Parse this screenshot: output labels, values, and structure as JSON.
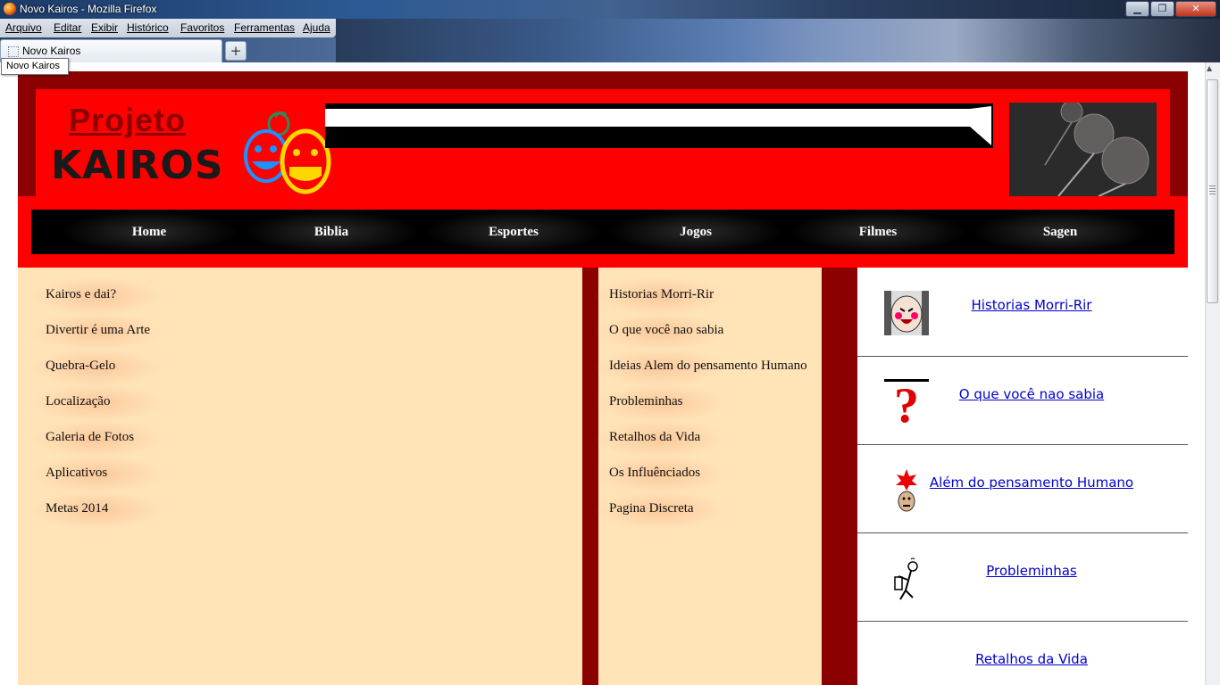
{
  "window": {
    "title": "Novo Kairos - Mozilla Firefox",
    "buttons": {
      "minimize": "▁",
      "maximize": "❐",
      "close": "✕"
    }
  },
  "menubar": [
    "Arquivo",
    "Editar",
    "Exibir",
    "Histórico",
    "Favoritos",
    "Ferramentas",
    "Ajuda"
  ],
  "tabs": {
    "active_label": "Novo Kairos",
    "new_tab": "+"
  },
  "tooltip": "Novo Kairos",
  "site": {
    "logo": {
      "line1": "Projeto",
      "line2": "KAIROS"
    },
    "nav": [
      "Home",
      "Biblia",
      "Esportes",
      "Jogos",
      "Filmes",
      "Sagen"
    ],
    "left_links": [
      "Kairos e dai?",
      "Divertir é uma Arte",
      "Quebra-Gelo",
      "Localização",
      "Galeria de Fotos",
      "Aplicativos",
      "Metas 2014"
    ],
    "middle_links": [
      "Historias Morri-Rir",
      "O que você nao sabia",
      "Ideias Alem do pensamento Humano",
      "Probleminhas",
      "Retalhos da Vida",
      "Os Influênciados",
      "Pagina Discreta"
    ],
    "cards": [
      {
        "label": "Historias Morri-Rir",
        "icon": "laughing-face-icon"
      },
      {
        "label": "O que você nao sabia",
        "icon": "question-mark-icon"
      },
      {
        "label": "Além do pensamento Humano",
        "icon": "exploding-head-icon"
      },
      {
        "label": "Probleminhas",
        "icon": "thinking-figure-icon"
      },
      {
        "label": "Retalhos da Vida",
        "icon": ""
      }
    ]
  },
  "colors": {
    "site_bg": "#8b0000",
    "header_red": "#ff0000",
    "nav_black": "#000000",
    "column_beige": "#ffe4b8",
    "link_blue": "#0000cc"
  }
}
